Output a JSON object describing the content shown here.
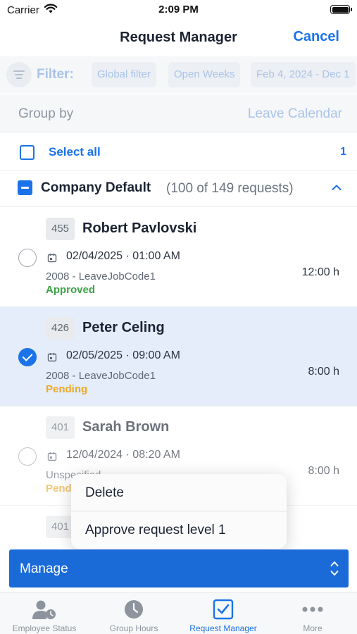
{
  "status_bar": {
    "carrier": "Carrier",
    "time": "2:09 PM"
  },
  "nav": {
    "title": "Request Manager",
    "cancel_label": "Cancel"
  },
  "filter": {
    "label": "Filter:",
    "chips": [
      "Global filter",
      "Open Weeks",
      "Feb 4, 2024 - Dec 1"
    ]
  },
  "group_by": {
    "label": "Group by",
    "value": "Leave Calendar"
  },
  "select_all": {
    "label": "Select all",
    "count": "1"
  },
  "group": {
    "name": "Company Default",
    "count": "(100 of 149 requests)"
  },
  "requests": [
    {
      "id": "455",
      "name": "Robert Pavlovski",
      "datetime": "02/04/2025 · 01:00 AM",
      "code": "2008 - LeaveJobCode1",
      "status": "Approved",
      "hours": "12:00 h",
      "selected": false
    },
    {
      "id": "426",
      "name": "Peter Celing",
      "datetime": "02/05/2025 · 09:00 AM",
      "code": "2008 - LeaveJobCode1",
      "status": "Pending",
      "hours": "8:00 h",
      "selected": true
    },
    {
      "id": "401",
      "name": "Sarah Brown",
      "datetime": "12/04/2024 · 08:20 AM",
      "code": "Unspecified",
      "status": "Pending",
      "hours": "8:00 h",
      "selected": false
    },
    {
      "id": "401"
    }
  ],
  "context_menu": {
    "items": [
      "Delete",
      "Approve request level 1"
    ]
  },
  "manage": {
    "label": "Manage"
  },
  "tabs": [
    {
      "label": "Employee Status",
      "icon": "employee-status-icon"
    },
    {
      "label": "Group Hours",
      "icon": "clock-icon"
    },
    {
      "label": "Request Manager",
      "icon": "checkbox-icon",
      "active": true
    },
    {
      "label": "More",
      "icon": "more-dots-icon"
    }
  ],
  "colors": {
    "accent": "#1a73e8",
    "approved": "#3aa345",
    "pending": "#f0a824",
    "selected_row": "#e4edf9"
  }
}
